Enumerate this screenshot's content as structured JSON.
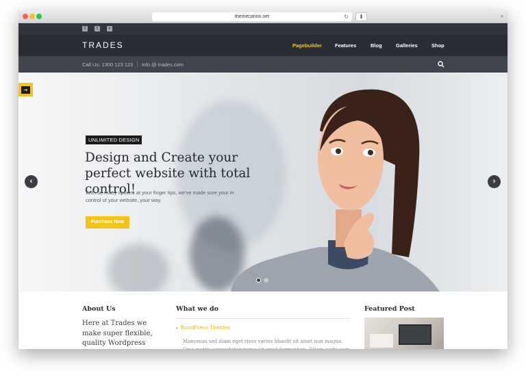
{
  "browser": {
    "url": "themecanon.net"
  },
  "site": {
    "logo": "TRADES",
    "nav": [
      "Pagebuilder",
      "Features",
      "Blog",
      "Galleries",
      "Shop"
    ],
    "phone": "Call Us: 1300 123 123",
    "email": "info @ trades.com"
  },
  "hero": {
    "badge": "UNLIMITED DESIGN",
    "headline": "Design and Create your perfect website with total control!",
    "subtext": "With so many options at your finger tips, we've made sure your in control of your website, your way.",
    "button": "Purchase Now"
  },
  "sections": {
    "about_title": "About Us",
    "about_text": "Here at Trades we make super flexible, quality Wordpress themes.",
    "what_title": "What we do",
    "what_item": "WordPress Themes",
    "what_text": "Maecenas sed diam eget risus varius blandit sit amet non magna. Cras mattis consectetur purus sit amet fermentum. Etiam porta sem.",
    "featured_title": "Featured Post"
  },
  "colors": {
    "accent": "#f4c517",
    "nav_bg": "#2a2d33",
    "topbar_bg": "#31353c",
    "infobar_bg": "#40444d"
  },
  "icons": [
    "facebook-icon",
    "twitter-icon",
    "rss-icon",
    "search-icon",
    "arrow-right-icon",
    "chevron-left-icon",
    "chevron-right-icon"
  ]
}
